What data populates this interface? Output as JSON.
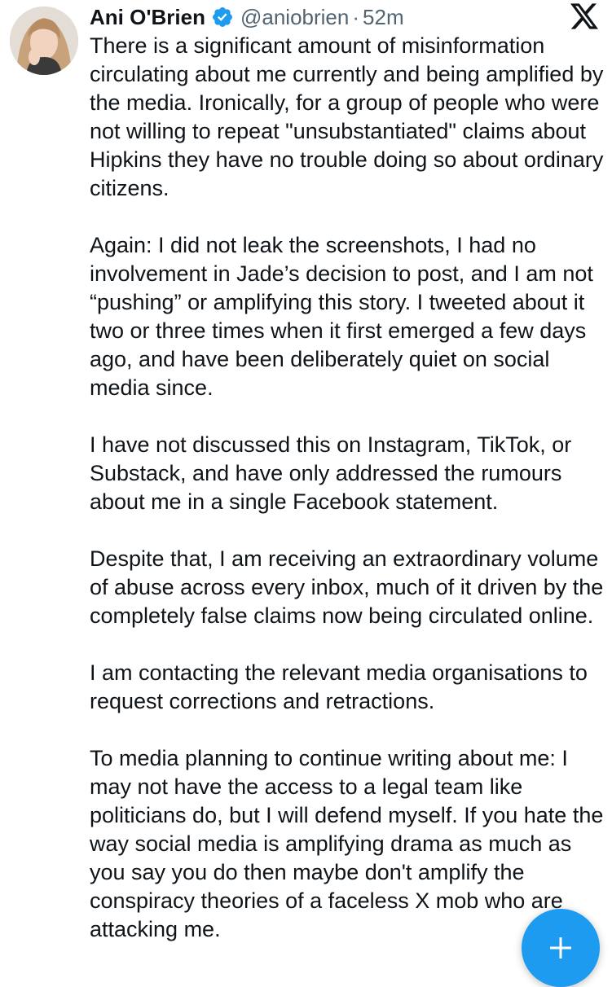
{
  "tweet": {
    "author": {
      "name": "Ani O'Brien",
      "handle": "@aniobrien",
      "verified": true
    },
    "separator": "·",
    "time": "52m",
    "paragraphs": [
      "There is a significant amount of misinformation circulating about me currently and being amplified by the media. Ironically, for a group of people who were not willing to repeat \"unsubstantiated\" claims about Hipkins they have no trouble doing so about ordinary citizens.",
      "Again: I did not leak the screenshots, I had no involvement in Jade’s decision to post, and I am not “pushing” or amplifying this story. I tweeted about it two or three times when it first emerged a few days ago, and have been deliberately quiet on social media since.",
      "I have not discussed this on Instagram, TikTok, or Substack, and have only addressed the rumours about me in a single Facebook statement.",
      "Despite that, I am receiving an extraordinary volume of abuse across every inbox, much of it driven by the completely false claims now being circulated online.",
      "I am contacting the relevant media organisations to request corrections and retractions.",
      "To media planning to continue writing about me: I may not have the access to a legal team like politicians do, but I will defend myself. If you hate the way social media is amplifying drama as much as you say you do then maybe don't amplify the conspiracy theories of a faceless X mob who are attacking me."
    ]
  },
  "icons": {
    "verified": "verified-badge-icon",
    "brand": "x-logo-icon",
    "compose": "plus-icon"
  },
  "colors": {
    "accent": "#1d9bf0",
    "text": "#0f1419",
    "secondary_text": "#536471",
    "background": "#ffffff"
  }
}
